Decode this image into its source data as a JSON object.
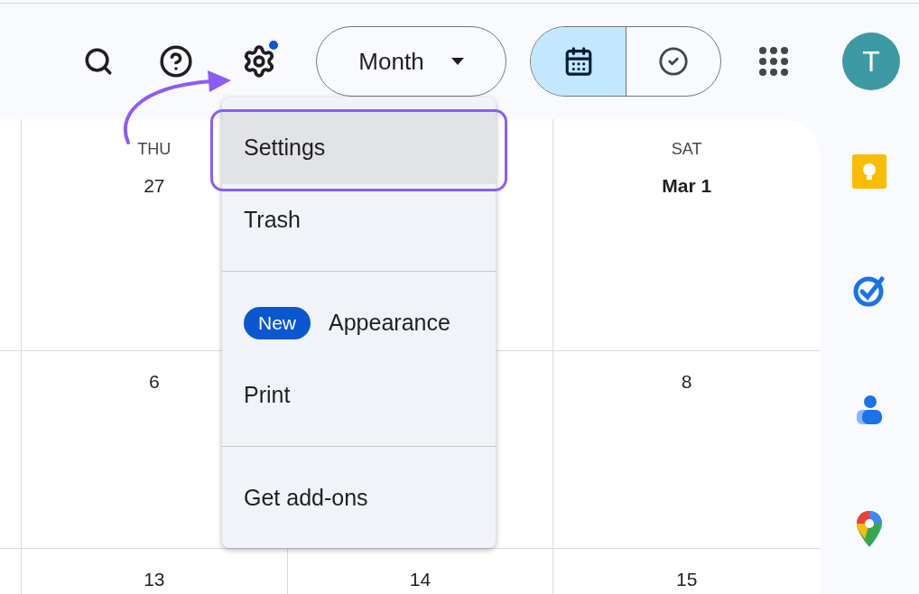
{
  "toolbar": {
    "settings_badge": true,
    "view_selector": {
      "label": "Month"
    },
    "view_toggle": [
      {
        "kind": "calendar",
        "selected": true
      },
      {
        "kind": "tasks",
        "selected": false
      }
    ],
    "avatar": {
      "initial": "T"
    }
  },
  "grid": {
    "rows": [
      [
        {
          "weekday": "THU",
          "date": "27"
        },
        {},
        {
          "weekday": "SAT",
          "date": "Mar 1",
          "bold": true
        }
      ],
      [
        {
          "date": "6"
        },
        {},
        {
          "date": "8"
        }
      ],
      [
        {
          "date": "13"
        },
        {
          "date": "14"
        },
        {
          "date": "15"
        }
      ]
    ]
  },
  "side_panel": [
    {
      "kind": "keep"
    },
    {
      "kind": "tasks"
    },
    {
      "kind": "contacts"
    },
    {
      "kind": "maps"
    }
  ],
  "menu": {
    "sections": [
      [
        {
          "label": "Settings",
          "selected": true
        },
        {
          "label": "Trash",
          "selected": false
        }
      ],
      [
        {
          "label": "Appearance",
          "badge": "New",
          "selected": false
        },
        {
          "label": "Print",
          "selected": false
        }
      ],
      [
        {
          "label": "Get add-ons",
          "selected": false
        }
      ]
    ]
  }
}
